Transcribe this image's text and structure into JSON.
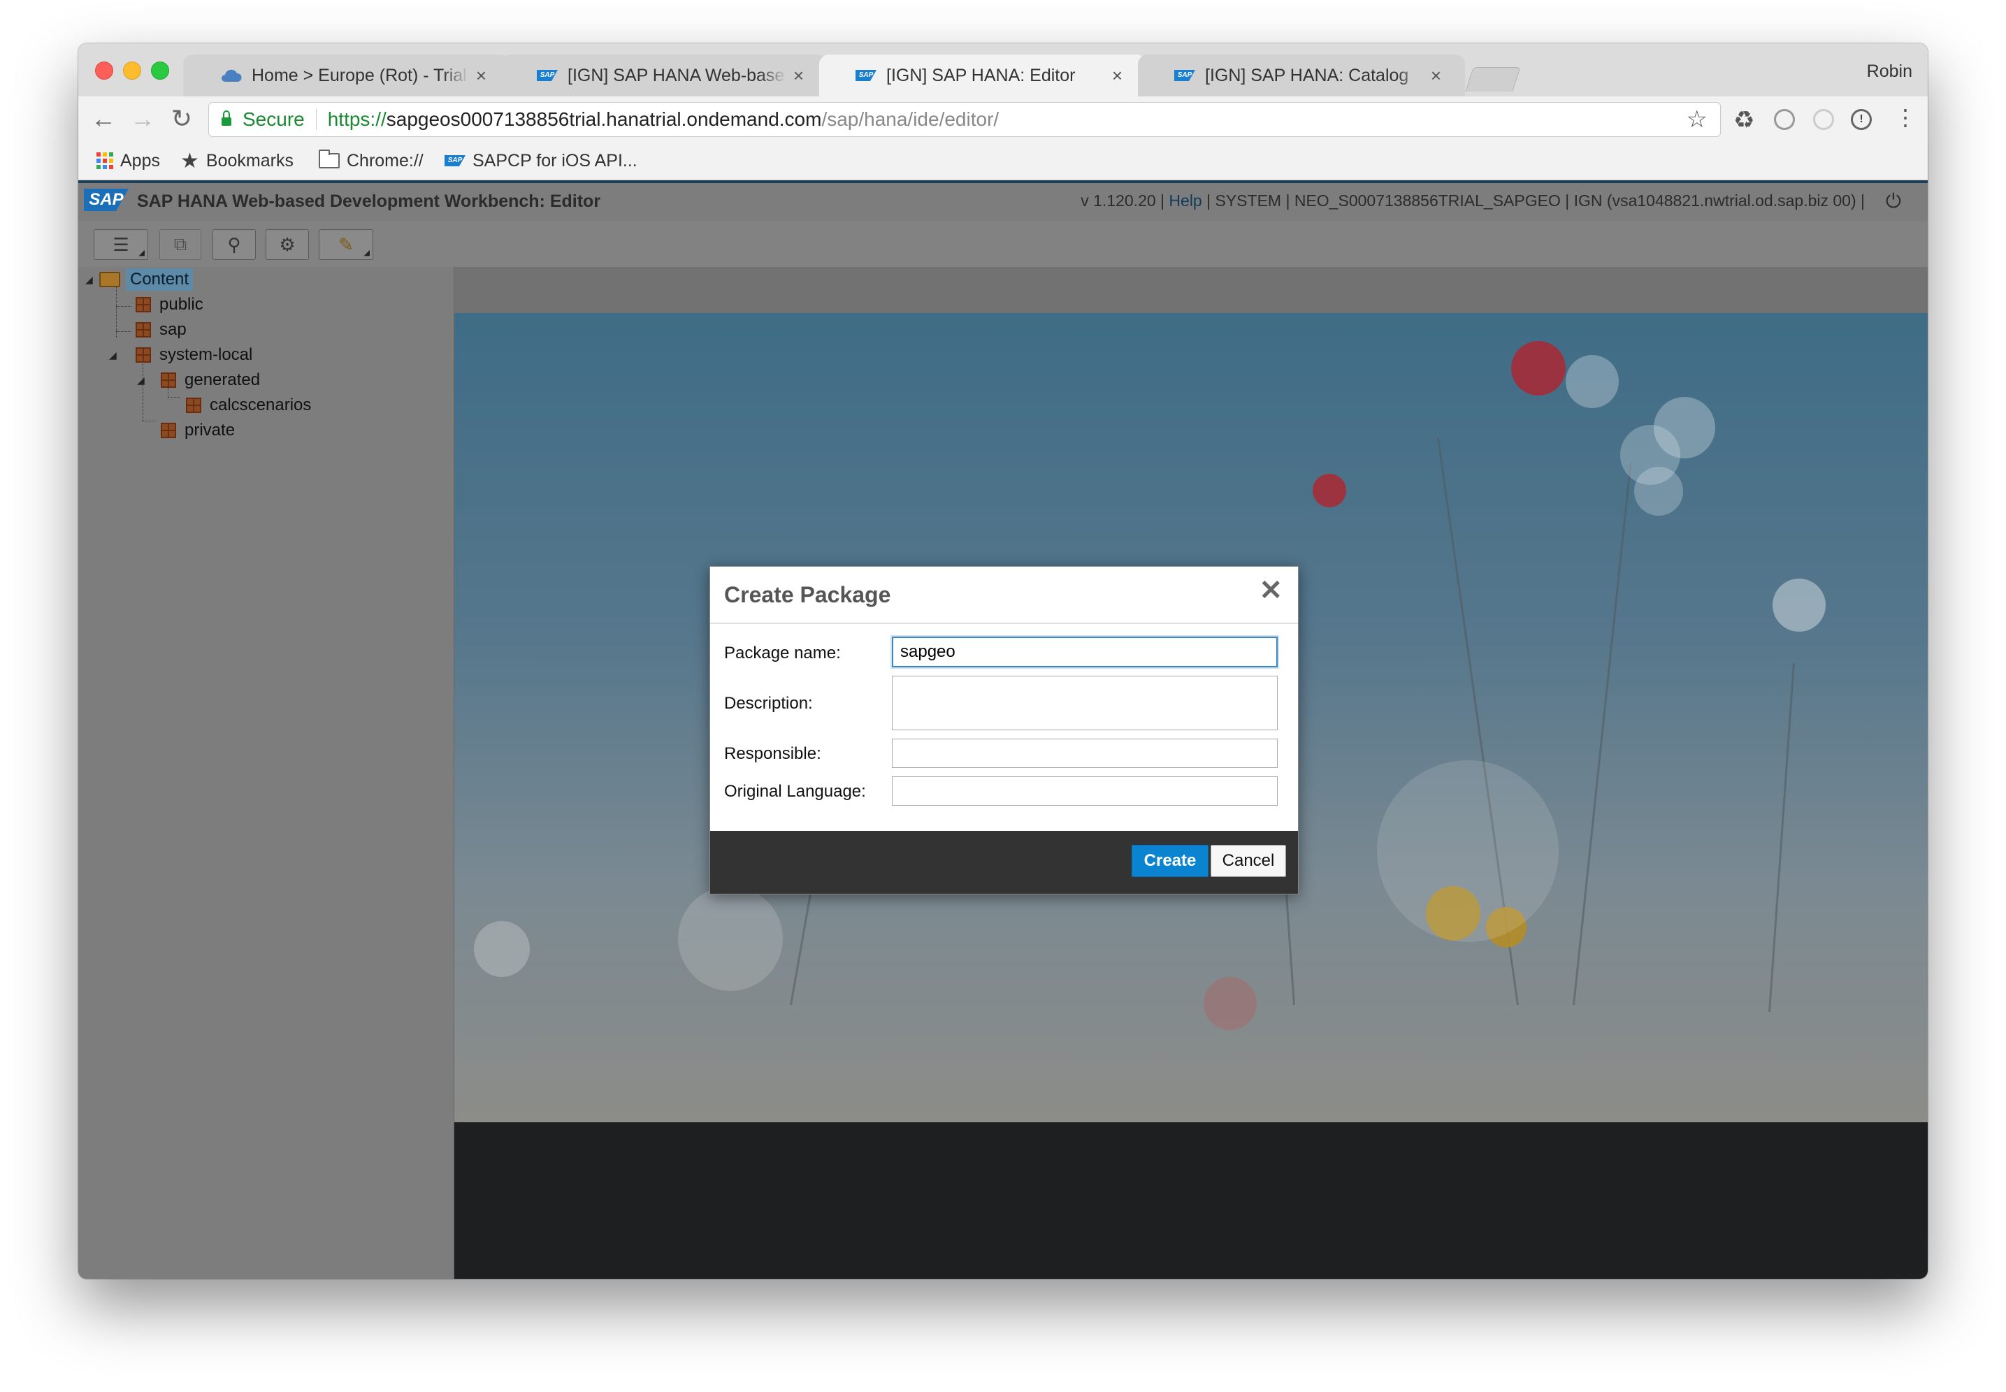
{
  "browser": {
    "profile_name": "Robin",
    "tabs": [
      {
        "title": "Home > Europe (Rot) - Trial > s",
        "icon": "cloud-icon",
        "active": false
      },
      {
        "title": "[IGN] SAP HANA Web-based D",
        "icon": "sap-icon",
        "active": false
      },
      {
        "title": "[IGN] SAP HANA: Editor",
        "icon": "sap-icon",
        "active": true
      },
      {
        "title": "[IGN] SAP HANA: Catalog",
        "icon": "sap-icon",
        "active": false
      }
    ],
    "tab_close_glyph": "×",
    "address": {
      "secure_label": "Secure",
      "scheme": "https://",
      "host": "sapgeos0007138856trial.hanatrial.ondemand.com",
      "path": "/sap/hana/ide/editor/"
    },
    "bookmarks": [
      {
        "label": "Apps",
        "icon": "apps-grid-icon"
      },
      {
        "label": "Bookmarks",
        "icon": "star-icon"
      },
      {
        "label": "Chrome://",
        "icon": "folder-icon"
      },
      {
        "label": "SAPCP for iOS API...",
        "icon": "sap-icon"
      }
    ]
  },
  "app": {
    "logo_text": "SAP",
    "title": "SAP HANA Web-based Development Workbench: Editor",
    "meta": {
      "version": "v 1.120.20",
      "help": "Help",
      "user": "SYSTEM",
      "schema": "NEO_S0007138856TRIAL_SAPGEO",
      "instance": "IGN (vsa1048821.nwtrial.od.sap.biz 00)",
      "divider": "|"
    },
    "toolbar": [
      "menu-icon",
      "copy-icon",
      "search-icon",
      "settings-icon",
      "tools-icon"
    ],
    "tree": {
      "root": "Content",
      "items": [
        {
          "label": "public"
        },
        {
          "label": "sap"
        },
        {
          "label": "system-local"
        },
        {
          "label": "generated"
        },
        {
          "label": "calcscenarios"
        },
        {
          "label": "private"
        }
      ]
    }
  },
  "dialog": {
    "title": "Create Package",
    "close_glyph": "✕",
    "fields": {
      "package_name": {
        "label": "Package name:",
        "value": "sapgeo"
      },
      "description": {
        "label": "Description:",
        "value": ""
      },
      "responsible": {
        "label": "Responsible:",
        "value": ""
      },
      "original_language": {
        "label": "Original Language:",
        "value": ""
      }
    },
    "create_label": "Create",
    "cancel_label": "Cancel"
  },
  "colors": {
    "sap_blue": "#1a6fb8",
    "create_button": "#0a83d1",
    "secure_green": "#1a8a32",
    "console_bg": "#1d1f21"
  }
}
